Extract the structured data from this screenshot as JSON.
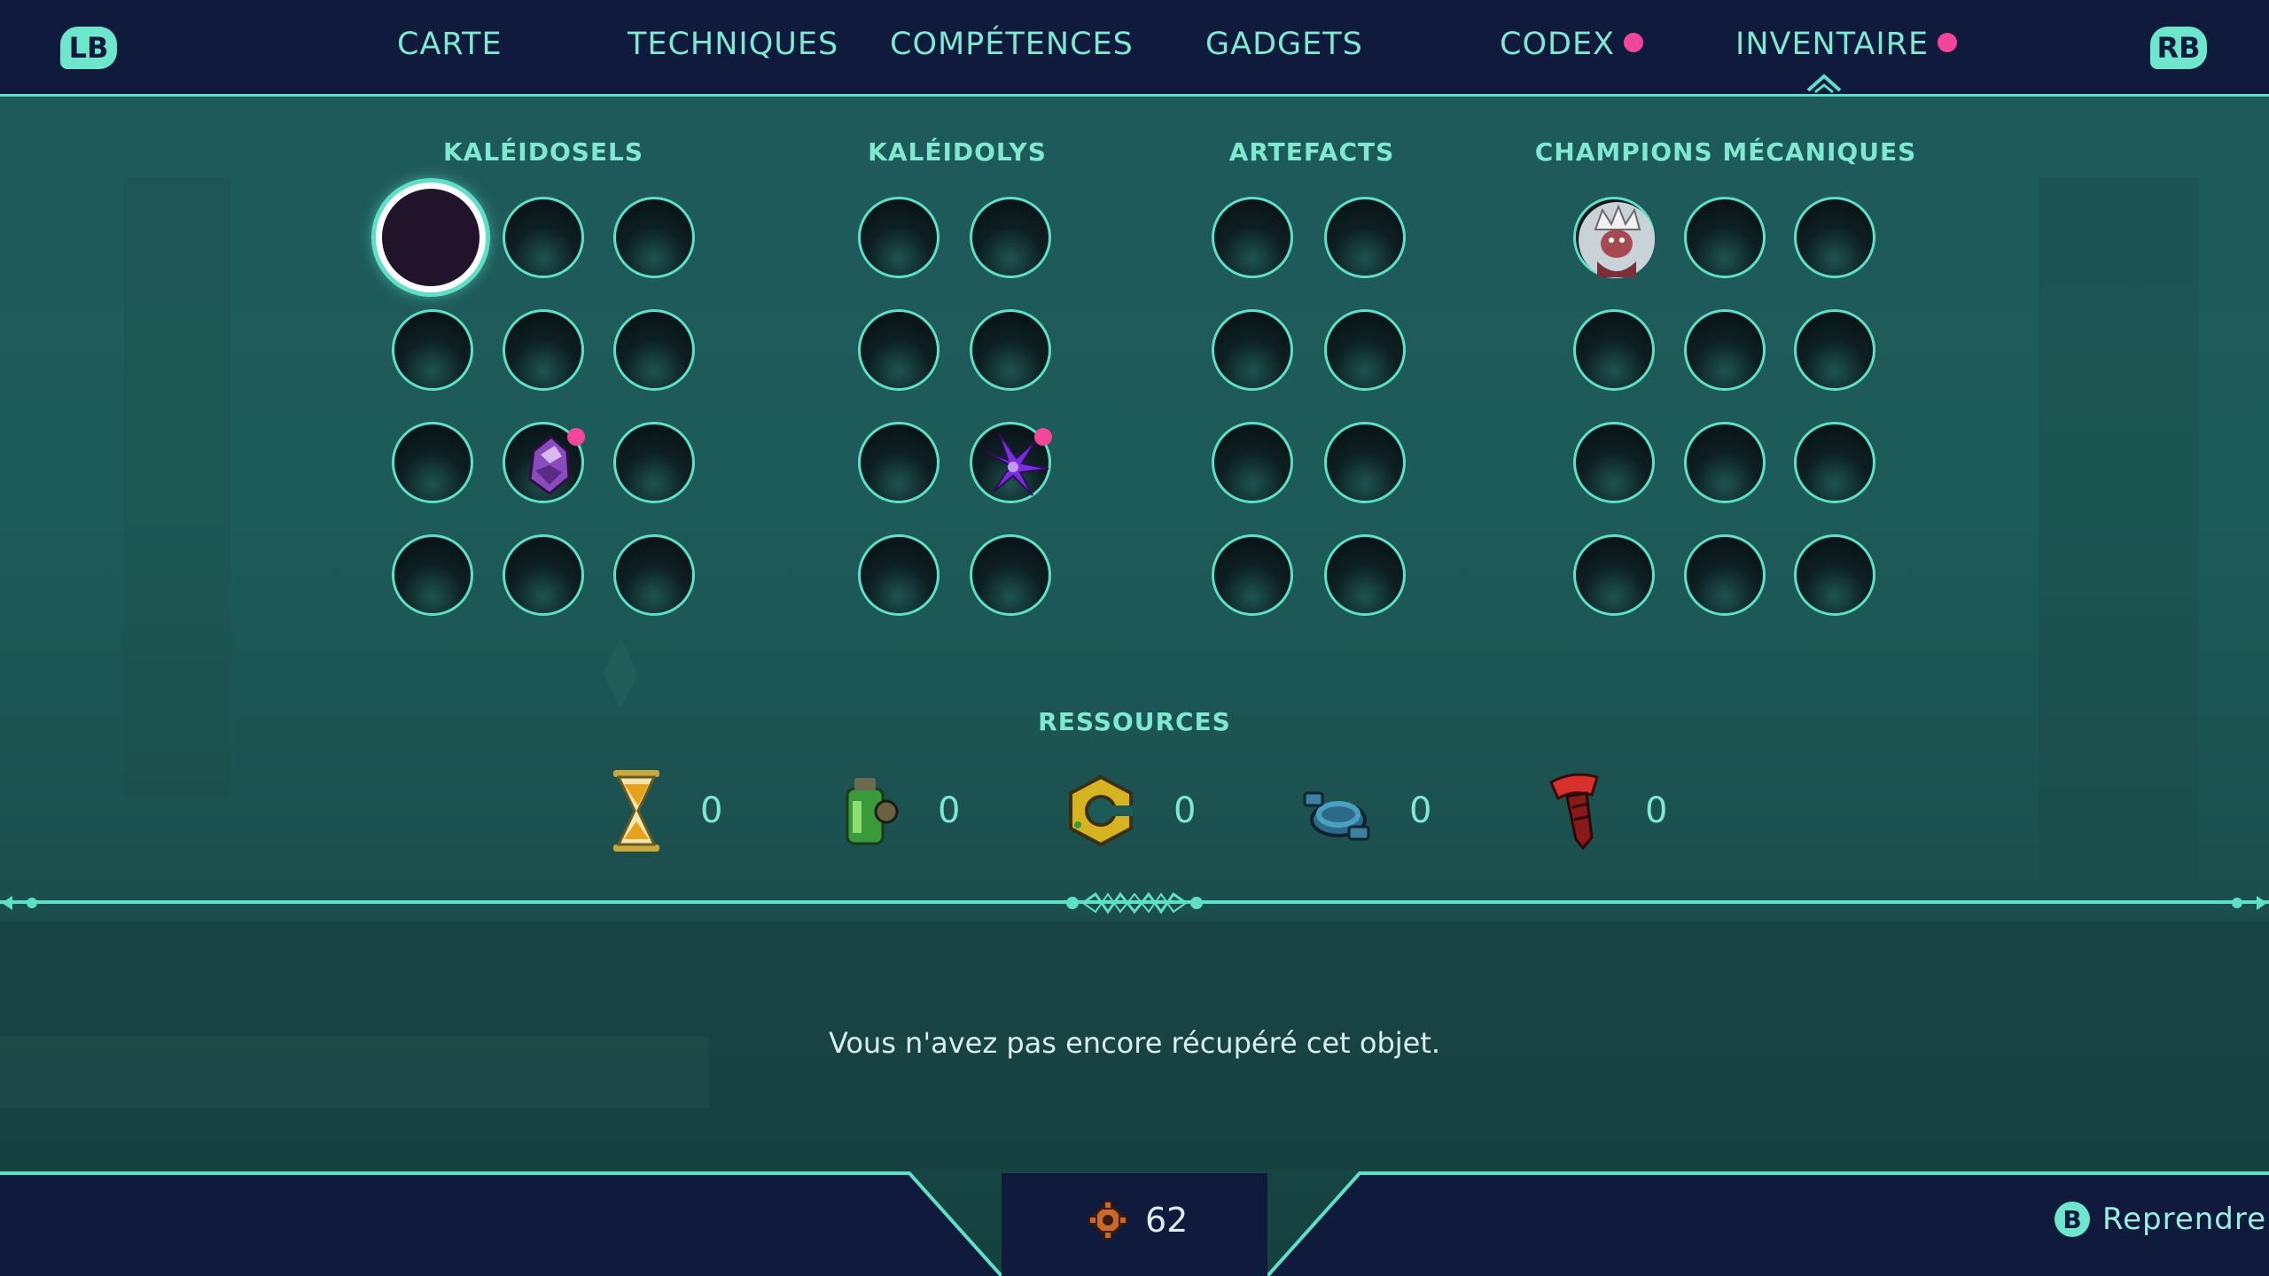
{
  "nav": {
    "left_bumper": "LB",
    "right_bumper": "RB",
    "tabs": [
      {
        "label": "CARTE",
        "notification": false
      },
      {
        "label": "TECHNIQUES",
        "notification": false
      },
      {
        "label": "COMPÉTENCES",
        "notification": false
      },
      {
        "label": "GADGETS",
        "notification": false
      },
      {
        "label": "CODEX",
        "notification": true
      },
      {
        "label": "INVENTAIRE",
        "notification": true,
        "active": true
      }
    ]
  },
  "sections": [
    {
      "title": "KALÉIDOSELS",
      "filled": [
        "purple-crystal-icon"
      ]
    },
    {
      "title": "KALÉIDOLYS",
      "filled": [
        "purple-flower-icon"
      ]
    },
    {
      "title": "ARTEFACTS"
    },
    {
      "title": "CHAMPIONS MÉCANIQUES",
      "filled": [
        "mechanical-champion-portrait-icon"
      ]
    }
  ],
  "resources": {
    "title": "RESSOURCES",
    "items": [
      {
        "icon": "hourglass-icon",
        "count": "0"
      },
      {
        "icon": "green-canister-icon",
        "count": "0"
      },
      {
        "icon": "golden-nut-icon",
        "count": "0"
      },
      {
        "icon": "blue-cable-icon",
        "count": "0"
      },
      {
        "icon": "red-drill-icon",
        "count": "0"
      }
    ]
  },
  "description": "Vous n'avez pas encore récupéré cet objet.",
  "footer": {
    "currency_icon": "cog-currency-icon",
    "currency_value": "62",
    "resume_button": "B",
    "resume_label": "Reprendre"
  },
  "colors": {
    "accent": "#5fe0c6",
    "bar": "#101a3c",
    "notification": "#f2469a"
  }
}
